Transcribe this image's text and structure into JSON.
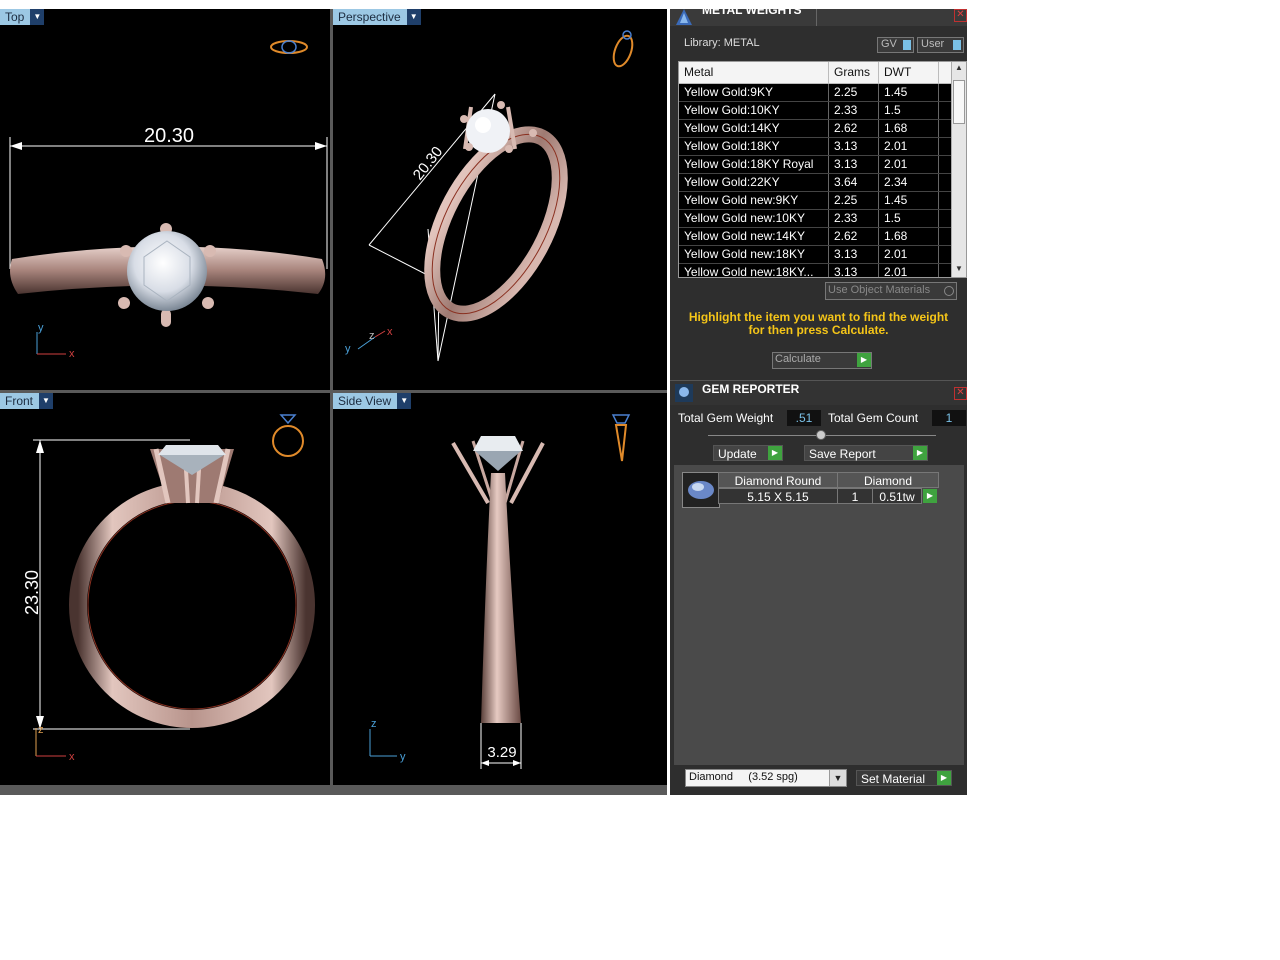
{
  "viewports": {
    "top": {
      "label": "Top",
      "dimension": "20.30",
      "axes": [
        "y",
        "x"
      ]
    },
    "perspective": {
      "label": "Perspective",
      "dimension": "20.30",
      "axes": [
        "y",
        "z",
        "x"
      ]
    },
    "front": {
      "label": "Front",
      "dimension": "23.30",
      "axes": [
        "z",
        "x"
      ]
    },
    "side": {
      "label": "Side View",
      "dimension": "3.29",
      "axes": [
        "z",
        "y"
      ]
    }
  },
  "metal_weights": {
    "title": "METAL WEIGHTS",
    "library_label": "Library: METAL",
    "gv_label": "GV",
    "user_label": "User",
    "columns": [
      "Metal",
      "Grams",
      "DWT"
    ],
    "rows": [
      [
        "Yellow Gold:9KY",
        "2.25",
        "1.45"
      ],
      [
        "Yellow Gold:10KY",
        "2.33",
        "1.5"
      ],
      [
        "Yellow Gold:14KY",
        "2.62",
        "1.68"
      ],
      [
        "Yellow Gold:18KY",
        "3.13",
        "2.01"
      ],
      [
        "Yellow Gold:18KY Royal",
        "3.13",
        "2.01"
      ],
      [
        "Yellow Gold:22KY",
        "3.64",
        "2.34"
      ],
      [
        "Yellow Gold new:9KY",
        "2.25",
        "1.45"
      ],
      [
        "Yellow Gold new:10KY",
        "2.33",
        "1.5"
      ],
      [
        "Yellow Gold new:14KY",
        "2.62",
        "1.68"
      ],
      [
        "Yellow Gold new:18KY",
        "3.13",
        "2.01"
      ],
      [
        "Yellow Gold new:18KY...",
        "3.13",
        "2.01"
      ]
    ],
    "use_object_materials": "Use Object Materials",
    "hint_line1": "Highlight the item you want to find the weight",
    "hint_line2": "for then press Calculate.",
    "calculate_label": "Calculate",
    "hint_color": "#f5c518"
  },
  "gem_reporter": {
    "title": "GEM REPORTER",
    "total_weight_label": "Total Gem Weight",
    "total_weight_value": ".51",
    "total_count_label": "Total Gem Count",
    "total_count_value": "1",
    "update_label": "Update",
    "save_report_label": "Save Report",
    "gem": {
      "shape": "Diamond Round",
      "material": "Diamond",
      "size": "5.15 X 5.15",
      "count": "1",
      "weight": "0.51tw"
    },
    "material_select": "Diamond     (3.52 spg)",
    "set_material_label": "Set Material"
  },
  "colors": {
    "viewport_tab": "#9cc8e4",
    "go_button": "#3fa33f",
    "ring_metal": "#c9a8a0"
  }
}
